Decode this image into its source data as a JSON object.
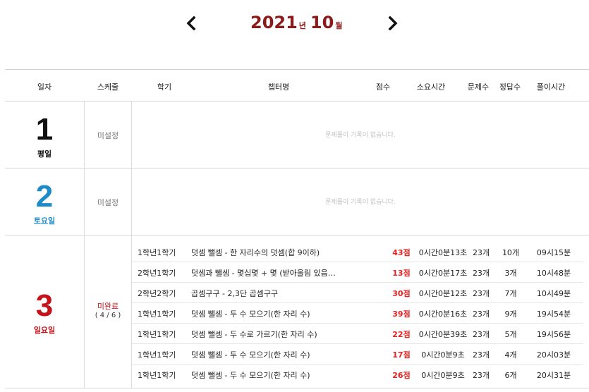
{
  "month_nav": {
    "year": "2021",
    "year_unit": "년",
    "month": "10",
    "month_unit": "월",
    "prev_icon": "chevron-left-icon",
    "next_icon": "chevron-right-icon"
  },
  "table": {
    "headers": [
      "일자",
      "스케줄",
      "학기",
      "챕터명",
      "점수",
      "소요시간",
      "문제수",
      "정답수",
      "풀이시간"
    ]
  },
  "days": [
    {
      "day": "1",
      "type": "평일",
      "color": "#111111",
      "schedule": "미설정",
      "empty_message": "문제풀이 기록이 없습니다."
    },
    {
      "day": "2",
      "type": "토요일",
      "color": "#1e8bc9",
      "schedule": "미설정",
      "empty_message": "문제풀이 기록이 없습니다."
    },
    {
      "day": "3",
      "type": "일요일",
      "color": "#c4141b",
      "schedule": "미완료",
      "schedule_color": "#c4141b",
      "schedule_progress": "( 4 / 6 )",
      "records": [
        {
          "semester": "1학년1학기",
          "chapter": "덧셈 뺄셈 - 한 자리수의 덧셈(합 9이하)",
          "score": "43점",
          "elapsed": "0시간0분13초",
          "questions": "23개",
          "correct": "10개",
          "solve_time": "09시15분"
        },
        {
          "semester": "2학년1학기",
          "chapter": "덧셈과 뺄셈 - 몇십몇 + 몇 (받아올림 있음…",
          "score": "13점",
          "elapsed": "0시간0분17초",
          "questions": "23개",
          "correct": "3개",
          "solve_time": "10시48분"
        },
        {
          "semester": "2학년2학기",
          "chapter": "곱셈구구 - 2,3단 곱셈구구",
          "score": "30점",
          "elapsed": "0시간0분12초",
          "questions": "23개",
          "correct": "7개",
          "solve_time": "10시49분"
        },
        {
          "semester": "1학년1학기",
          "chapter": "덧셈 뺄셈 - 두 수 모으기(한 자리 수)",
          "score": "39점",
          "elapsed": "0시간0분16초",
          "questions": "23개",
          "correct": "9개",
          "solve_time": "19시54분"
        },
        {
          "semester": "1학년1학기",
          "chapter": "덧셈 뺄셈 - 두 수로 가르기(한 자리 수)",
          "score": "22점",
          "elapsed": "0시간0분39초",
          "questions": "23개",
          "correct": "5개",
          "solve_time": "19시56분"
        },
        {
          "semester": "1학년1학기",
          "chapter": "덧셈 뺄셈 - 두 수 모으기(한 자리 수)",
          "score": "17점",
          "elapsed": "0시간0분9초",
          "questions": "23개",
          "correct": "4개",
          "solve_time": "20시03분"
        },
        {
          "semester": "1학년1학기",
          "chapter": "덧셈 뺄셈 - 두 수 모으기(한 자리 수)",
          "score": "26점",
          "elapsed": "0시간0분9초",
          "questions": "23개",
          "correct": "6개",
          "solve_time": "20시31분"
        }
      ]
    }
  ]
}
